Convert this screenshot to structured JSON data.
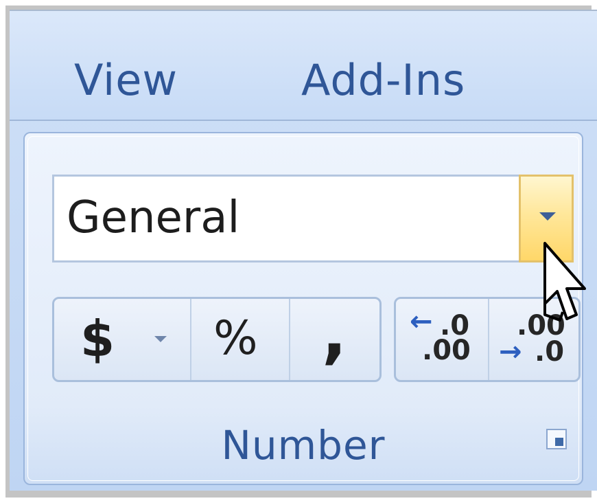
{
  "ribbon": {
    "tabs": [
      {
        "label": "View"
      },
      {
        "label": "Add-Ins"
      }
    ],
    "number_group": {
      "format_combo": {
        "value": "General"
      },
      "buttons": {
        "currency": "$",
        "percent": "%",
        "comma": ",",
        "increase_decimal": {
          "top": ".0",
          "bottom": ".00"
        },
        "decrease_decimal": {
          "top": ".00",
          "bottom": ".0"
        }
      },
      "label": "Number"
    }
  },
  "icons": {
    "format_dropdown": "chevron-down-icon",
    "currency_dropdown": "chevron-down-icon",
    "dialog_launcher": "dialog-launcher-icon",
    "mouse_pointer": "hand-pointer-icon"
  },
  "colors": {
    "tab_text": "#2f5697",
    "hover_highlight": "#ffd769",
    "group_border": "#9ab5dc"
  }
}
